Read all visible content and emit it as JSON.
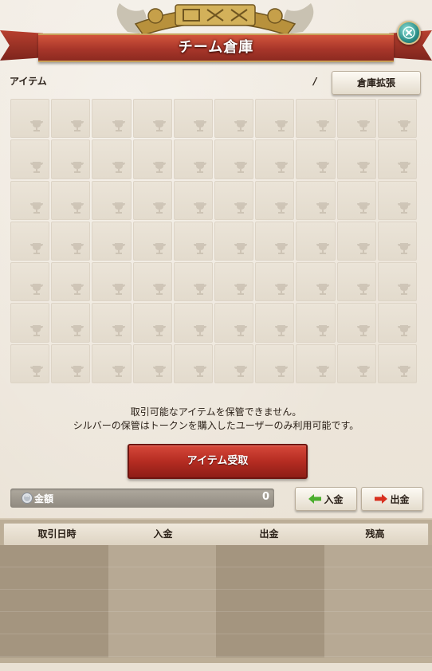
{
  "header": {
    "title": "チーム倉庫"
  },
  "items_section": {
    "label": "アイテム",
    "capacity_separator": "/",
    "expand_button_label": "倉庫拡張"
  },
  "notice": {
    "line1": "取引可能なアイテムを保管できません。",
    "line2": "シルバーの保管はトークンを購入したユーザーのみ利用可能です。"
  },
  "receive_button_label": "アイテム受取",
  "funds": {
    "label": "金額",
    "value": "0",
    "deposit_label": "入金",
    "withdraw_label": "出金"
  },
  "ledger": {
    "columns": [
      "取引日時",
      "入金",
      "出金",
      "残高"
    ]
  },
  "colors": {
    "banner_red": "#b23a2c",
    "button_red": "#b52c22",
    "deposit_arrow": "#4cae2e",
    "withdraw_arrow": "#d8301f",
    "close_teal": "#2c8f88"
  }
}
